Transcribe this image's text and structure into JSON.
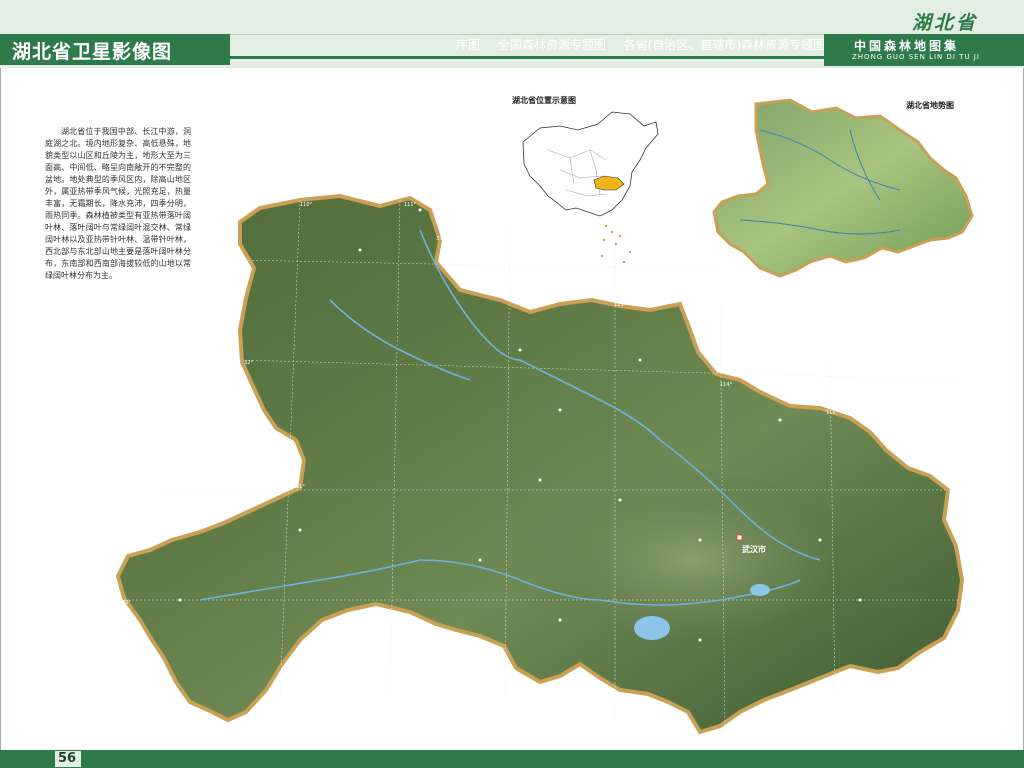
{
  "header": {
    "title": "湖北省卫星影像图",
    "breadcrumb": [
      "序图",
      "全国森林资源专题图",
      "各省(自治区、直辖市)森林资源专题图"
    ],
    "province_badge": "湖北省",
    "atlas_title_cn": "中国森林地图集",
    "atlas_title_py": "ZHONG GUO SEN LIN DI TU JI"
  },
  "description": "湖北省位于我国中部、长江中游，洞庭湖之北。境内地形复杂、高低悬殊，地貌类型以山区和丘陵为主，地形大至为三面高、中间低、略呈向南敞开的不完整的盆地。地处典型的季风区内，除高山地区外，属亚热带季风气候，光照充足，热量丰富，无霜期长，降水充沛，四季分明，雨热同季。森林植被类型有亚热带落叶阔叶林、落叶阔叶与常绿阔叶混交林、常绿阔叶林以及亚热带针叶林、温带针叶林，西北部与东北部山地主要是落叶阔叶林分布，东南部和西南部海拔较低的山地以常绿阔叶林分布为主。",
  "insets": {
    "location_caption": "湖北省位置示意图",
    "terrain_caption": "湖北省地势图"
  },
  "map": {
    "capital_label": "武汉市",
    "grid_labels": {
      "lon_top": [
        "110°",
        "111°",
        "112°",
        "113°",
        "114°",
        "115°",
        "116°"
      ],
      "lat_left": [
        "33°",
        "32°",
        "31°",
        "30°",
        "29°"
      ]
    }
  },
  "footer": {
    "page_number": "56"
  },
  "colors": {
    "brand_green": "#2e7a4a",
    "band_light": "#e3eee2",
    "province_highlight": "#f2b21a",
    "map_border": "#c9a055"
  }
}
